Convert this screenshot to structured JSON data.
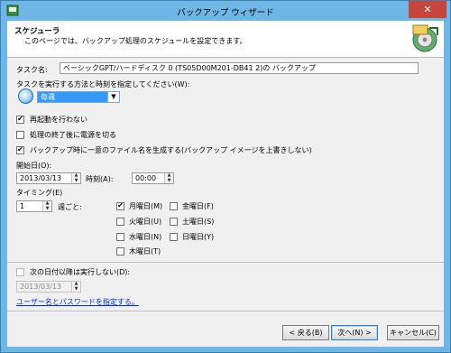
{
  "window": {
    "title": "バックアップ ウィザード",
    "close_glyph": "✕"
  },
  "header": {
    "title": "スケジューラ",
    "description": "このページでは、バックアップ処理のスケジュールを設定できます。"
  },
  "task": {
    "name_label": "タスク名:",
    "name_value": "ベーシックGPT/ハードディスク 0 (TS05D00M201-DB41 2)の バックアップ"
  },
  "method": {
    "label": "タスクを実行する方法と時刻を指定してください(W):",
    "selected": "毎週"
  },
  "options": [
    {
      "label": "再起動を行わない",
      "checked": true
    },
    {
      "label": "処理の終了後に電源を切る",
      "checked": false
    },
    {
      "label": "バックアップ時に一意のファイル名を生成する(バックアップ イメージを上書きしない)",
      "checked": true
    }
  ],
  "start": {
    "label": "開始日(O):",
    "date": "2013/03/13",
    "time_label": "時刻(A):",
    "time": "00:00"
  },
  "timing": {
    "label": "タイミング(E)",
    "weeks": "1",
    "weeks_suffix": "週ごと:"
  },
  "days": [
    {
      "label": "月曜日(M)",
      "checked": true
    },
    {
      "label": "金曜日(F)",
      "checked": false
    },
    {
      "label": "火曜日(U)",
      "checked": false
    },
    {
      "label": "土曜日(S)",
      "checked": false
    },
    {
      "label": "水曜日(N)",
      "checked": false
    },
    {
      "label": "日曜日(Y)",
      "checked": false
    },
    {
      "label": "木曜日(T)",
      "checked": false
    }
  ],
  "skip": {
    "label": "次の日付以降は実行しない(D):",
    "checked": false,
    "date": "2013/03/13"
  },
  "user_link": "ユーザー名とパスワードを指定する。",
  "buttons": {
    "back": "< 戻る(B)",
    "next": "次へ(N) >",
    "cancel": "キャンセル(C)"
  },
  "colors": {
    "title_bar": "#6db6e6",
    "close_button": "#c7463c",
    "selection": "#3399ff",
    "link": "#0033cc"
  }
}
